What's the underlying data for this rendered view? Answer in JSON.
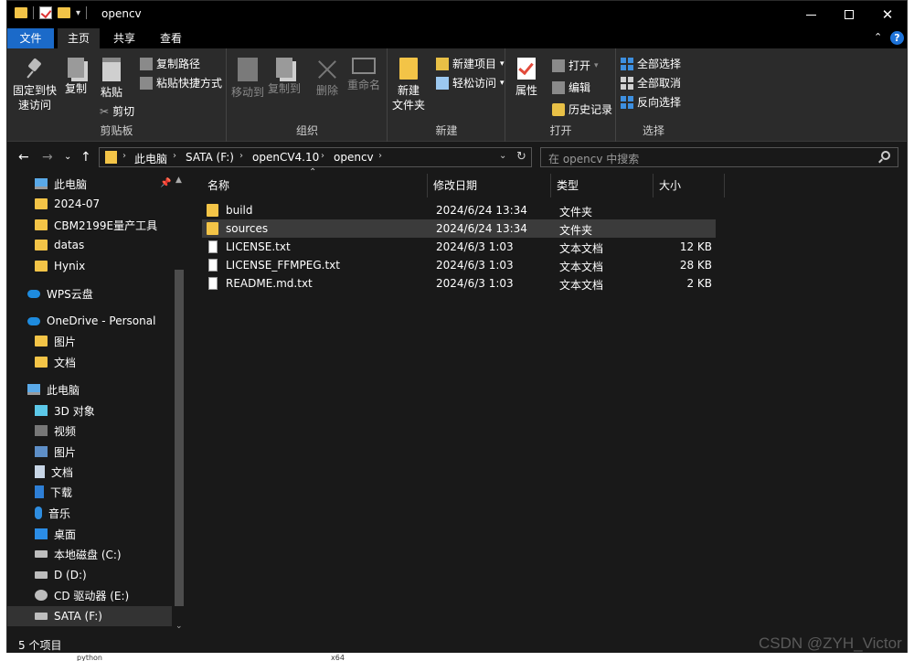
{
  "window": {
    "title": "opencv"
  },
  "ribbon_tabs": [
    "文件",
    "主页",
    "共享",
    "查看"
  ],
  "ribbon": {
    "clipboard": {
      "pin_line1": "固定到快",
      "pin_line2": "速访问",
      "copy": "复制",
      "paste": "粘贴",
      "copy_path": "复制路径",
      "paste_shortcut": "粘贴快捷方式",
      "cut": "剪切",
      "label": "剪贴板"
    },
    "organize": {
      "move_to": "移动到",
      "copy_to": "复制到",
      "delete": "删除",
      "rename": "重命名",
      "label": "组织"
    },
    "new": {
      "new_folder_line1": "新建",
      "new_folder_line2": "文件夹",
      "new_item": "新建项目",
      "easy_access": "轻松访问",
      "label": "新建"
    },
    "open": {
      "properties": "属性",
      "open": "打开",
      "edit": "编辑",
      "history": "历史记录",
      "label": "打开"
    },
    "select": {
      "select_all": "全部选择",
      "select_none": "全部取消",
      "invert": "反向选择",
      "label": "选择"
    }
  },
  "address": {
    "crumbs": [
      "此电脑",
      "SATA (F:)",
      "openCV4.10",
      "opencv"
    ],
    "search_placeholder": "在 opencv 中搜索"
  },
  "sidebar": [
    {
      "label": "此电脑",
      "icon": "pc-icon",
      "indent": 1,
      "pinned": true
    },
    {
      "label": "2024-07",
      "icon": "folder-icon",
      "indent": 1
    },
    {
      "label": "CBM2199E量产工具",
      "icon": "folder-icon",
      "indent": 1
    },
    {
      "label": "datas",
      "icon": "folder-icon",
      "indent": 1
    },
    {
      "label": "Hynix",
      "icon": "folder-icon",
      "indent": 1
    },
    {
      "label": "WPS云盘",
      "icon": "cloud-icon",
      "indent": 0
    },
    {
      "label": "OneDrive - Personal",
      "icon": "cloud-icon",
      "indent": 0
    },
    {
      "label": "图片",
      "icon": "folder-icon",
      "indent": 1
    },
    {
      "label": "文档",
      "icon": "folder-icon",
      "indent": 1
    },
    {
      "label": "此电脑",
      "icon": "pc-icon",
      "indent": 0
    },
    {
      "label": "3D 对象",
      "icon": "cube-icon",
      "indent": 1
    },
    {
      "label": "视频",
      "icon": "video-icon",
      "indent": 1
    },
    {
      "label": "图片",
      "icon": "pictures-icon",
      "indent": 1
    },
    {
      "label": "文档",
      "icon": "documents-icon",
      "indent": 1
    },
    {
      "label": "下载",
      "icon": "download-icon",
      "indent": 1
    },
    {
      "label": "音乐",
      "icon": "music-icon",
      "indent": 1
    },
    {
      "label": "桌面",
      "icon": "desktop-icon",
      "indent": 1
    },
    {
      "label": "本地磁盘 (C:)",
      "icon": "disk-icon",
      "indent": 1
    },
    {
      "label": "D (D:)",
      "icon": "disk-icon",
      "indent": 1
    },
    {
      "label": "CD 驱动器 (E:)",
      "icon": "cd-icon",
      "indent": 1
    },
    {
      "label": "SATA (F:)",
      "icon": "disk-icon",
      "indent": 1,
      "selected": true
    }
  ],
  "columns": {
    "name": "名称",
    "modified": "修改日期",
    "type": "类型",
    "size": "大小"
  },
  "files": [
    {
      "name": "build",
      "modified": "2024/6/24 13:34",
      "type": "文件夹",
      "size": "",
      "kind": "folder"
    },
    {
      "name": "sources",
      "modified": "2024/6/24 13:34",
      "type": "文件夹",
      "size": "",
      "kind": "folder",
      "selected": true
    },
    {
      "name": "LICENSE.txt",
      "modified": "2024/6/3 1:03",
      "type": "文本文档",
      "size": "12 KB",
      "kind": "txt"
    },
    {
      "name": "LICENSE_FFMPEG.txt",
      "modified": "2024/6/3 1:03",
      "type": "文本文档",
      "size": "28 KB",
      "kind": "txt"
    },
    {
      "name": "README.md.txt",
      "modified": "2024/6/3 1:03",
      "type": "文本文档",
      "size": "2 KB",
      "kind": "txt"
    }
  ],
  "status": {
    "item_count": "5 个项目"
  },
  "watermark": "CSDN @ZYH_Victor",
  "background_fragments": [
    "python",
    "x64"
  ],
  "colors": {
    "accent": "#1b6ac9",
    "folder": "#f3c447",
    "window_bg": "#191919",
    "ribbon_bg": "#2b2b2b"
  }
}
